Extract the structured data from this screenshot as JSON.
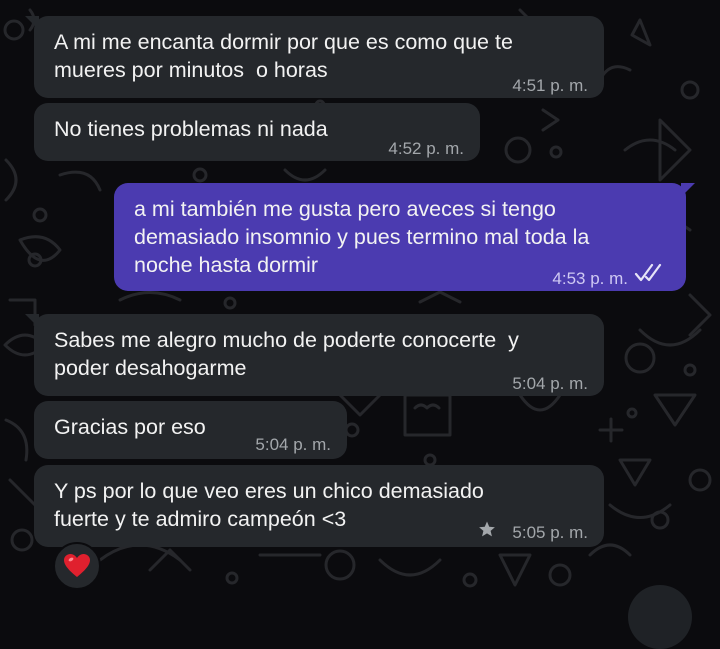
{
  "messages": [
    {
      "direction": "in",
      "text": "A mi me encanta dormir por que es como que te\nmueres por minutos  o horas",
      "time": "4:51 p. m."
    },
    {
      "direction": "in",
      "text": "No tienes problemas ni nada",
      "time": "4:52 p. m."
    },
    {
      "direction": "out",
      "text": "a mi también me gusta pero aveces si tengo\ndemasiado insomnio y pues termino mal toda la\nnoche hasta dormir",
      "time": "4:53 p. m.",
      "status": "read"
    },
    {
      "direction": "in",
      "text": "Sabes me alegro mucho de poderte conocerte  y\npoder desahogarme",
      "time": "5:04 p. m."
    },
    {
      "direction": "in",
      "text": "Gracias por eso",
      "time": "5:04 p. m."
    },
    {
      "direction": "in",
      "text": "Y ps por lo que veo eres un chico demasiado\nfuerte y te admiro campeón <3",
      "time": "5:05 p. m.",
      "starred": true,
      "reaction": "❤️"
    }
  ],
  "colors": {
    "background": "#0b0b0e",
    "incoming_bubble": "#25282c",
    "outgoing_bubble": "#4b3bb0",
    "read_ticks": "#e6e3f7",
    "heart": "#e0202e"
  },
  "icons": {
    "read_status": "double-check-icon",
    "starred": "star-icon",
    "reaction": "red-heart-icon",
    "wallpaper": "doodle-pattern"
  }
}
